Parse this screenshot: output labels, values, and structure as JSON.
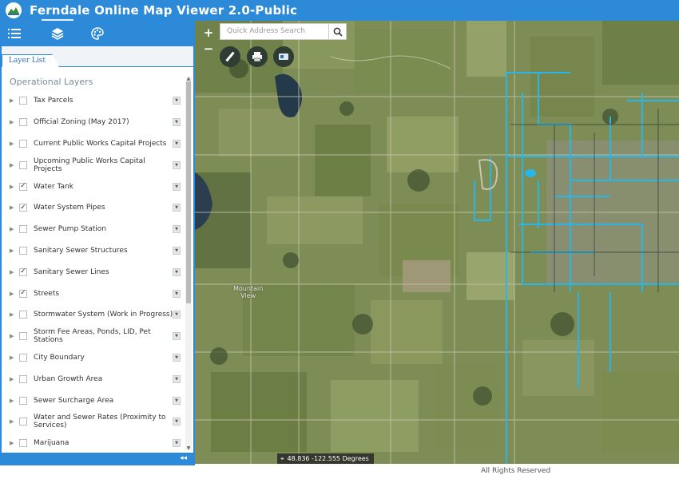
{
  "app": {
    "title": "Ferndale Online Map Viewer 2.0-Public",
    "accent": "#2c8ad8"
  },
  "toolbar": {
    "buttons": [
      {
        "name": "layer-list-toolbar-button",
        "icon": "list-icon"
      },
      {
        "name": "basemap-toolbar-button",
        "icon": "layers-icon"
      },
      {
        "name": "legend-toolbar-button",
        "icon": "palette-icon"
      }
    ]
  },
  "panel": {
    "tab_label": "Layer List",
    "section_title": "Operational Layers",
    "layers": [
      {
        "label": "Tax Parcels",
        "checked": false
      },
      {
        "label": "Official Zoning (May 2017)",
        "checked": false
      },
      {
        "label": "Current Public Works Capital Projects",
        "checked": false
      },
      {
        "label": "Upcoming Public Works Capital Projects",
        "checked": false
      },
      {
        "label": "Water Tank",
        "checked": true
      },
      {
        "label": "Water System Pipes",
        "checked": true
      },
      {
        "label": "Sewer Pump Station",
        "checked": false
      },
      {
        "label": "Sanitary Sewer Structures",
        "checked": false
      },
      {
        "label": "Sanitary Sewer Lines",
        "checked": true
      },
      {
        "label": "Streets",
        "checked": true
      },
      {
        "label": "Stormwater System (Work in Progress)",
        "checked": false
      },
      {
        "label": "Storm Fee Areas, Ponds, LID, Pet Stations",
        "checked": false
      },
      {
        "label": "City Boundary",
        "checked": false
      },
      {
        "label": "Urban Growth Area",
        "checked": false
      },
      {
        "label": "Sewer Surcharge Area",
        "checked": false
      },
      {
        "label": "Water and Sewer Rates (Proximity to Services)",
        "checked": false
      },
      {
        "label": "Marijuana",
        "checked": false
      }
    ]
  },
  "map": {
    "zoom_in": "+",
    "zoom_out": "−",
    "search_placeholder": "Quick Address Search",
    "coordinates": "48.836 -122.555 Degrees",
    "place_label": "Mountain\nView",
    "pipe_color": "#27b6e8"
  },
  "footer": {
    "copyright": "All Rights Reserved"
  }
}
